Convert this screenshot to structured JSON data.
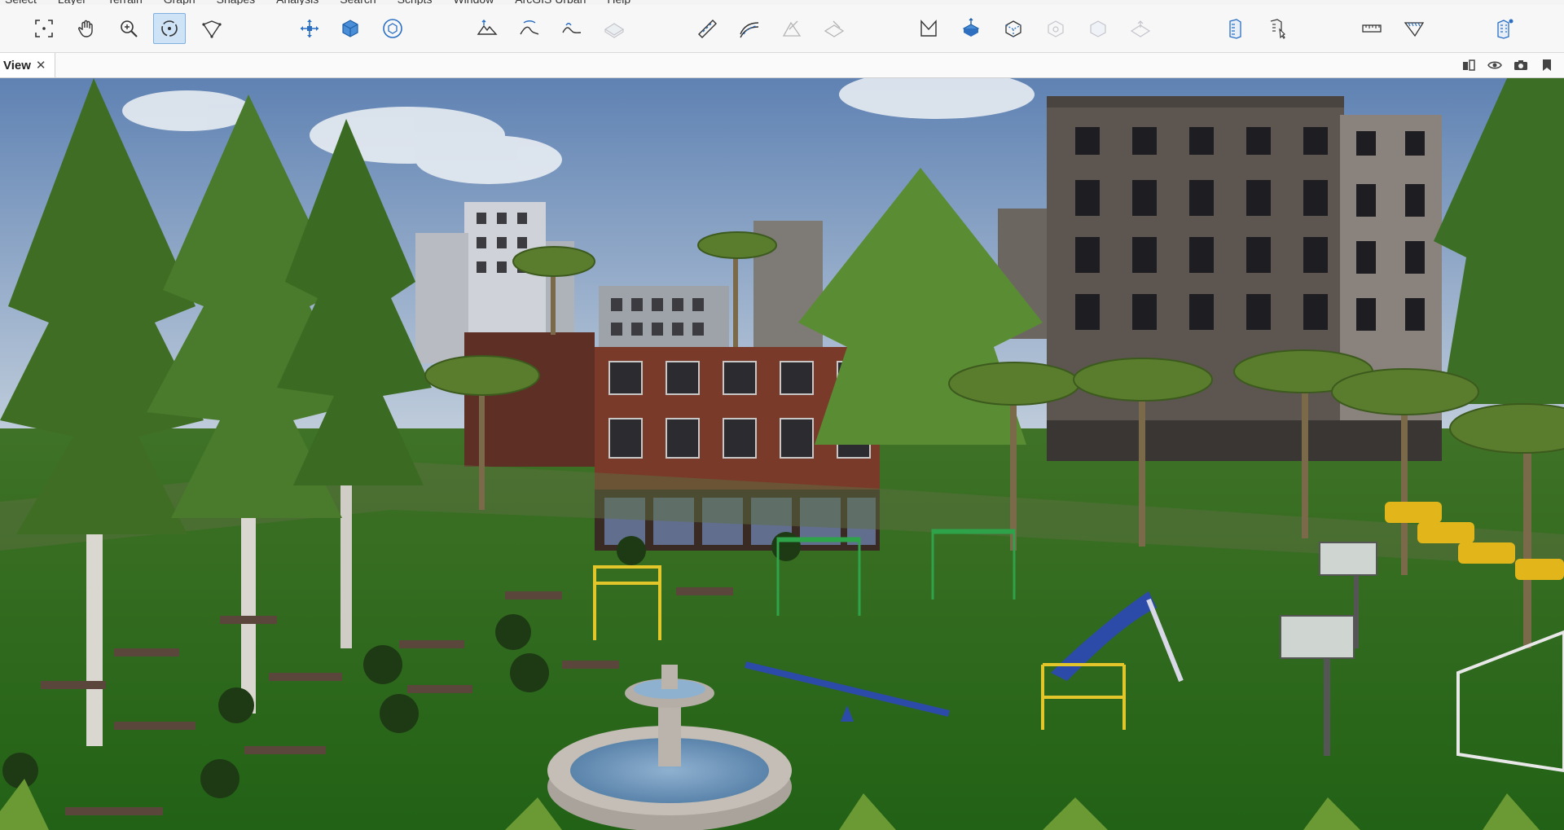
{
  "menubar": {
    "items": [
      "Select",
      "Layer",
      "Terrain",
      "Graph",
      "Shapes",
      "Analysis",
      "Search",
      "Scripts",
      "Window",
      "ArcGIS Urban",
      "Help"
    ]
  },
  "toolbar": {
    "groups": [
      {
        "name": "navigation",
        "tools": [
          "frame-icon",
          "pan-hand-icon",
          "zoom-icon",
          "orbit-icon",
          "fly-path-icon"
        ]
      },
      {
        "name": "transform",
        "tools": [
          "move-icon",
          "box-icon",
          "rotate-box-icon"
        ]
      },
      {
        "name": "terrain",
        "tools": [
          "terrain-raise-icon",
          "terrain-smooth-icon",
          "terrain-flatten-icon",
          "terrain-disabled-icon"
        ]
      },
      {
        "name": "street",
        "tools": [
          "street-straight-icon",
          "street-curve-icon",
          "street-edit-icon",
          "street-split-icon"
        ]
      },
      {
        "name": "shape",
        "tools": [
          "polygon-icon",
          "extrude-icon",
          "cube-outline-icon",
          "cube-dim-icon",
          "cube-ghost-icon",
          "cube-flat-icon"
        ]
      },
      {
        "name": "building",
        "tools": [
          "building-icon",
          "building-select-icon"
        ]
      },
      {
        "name": "measure",
        "tools": [
          "ruler-icon",
          "measure-area-icon"
        ]
      },
      {
        "name": "urban",
        "tools": [
          "urban-building-icon"
        ]
      }
    ],
    "active_tool": "orbit-icon"
  },
  "view_panel": {
    "tab_label": "View",
    "close_label": "✕",
    "right_icons": [
      "layout-icon",
      "visibility-icon",
      "camera-icon",
      "bookmark-icon"
    ]
  },
  "scene": {
    "sky_top": "#6f8fb9",
    "grass": "#2e6a1f",
    "brick": "#7a3a2a",
    "stone_building": "#5c5550",
    "fountain": "#b9b4ad"
  }
}
